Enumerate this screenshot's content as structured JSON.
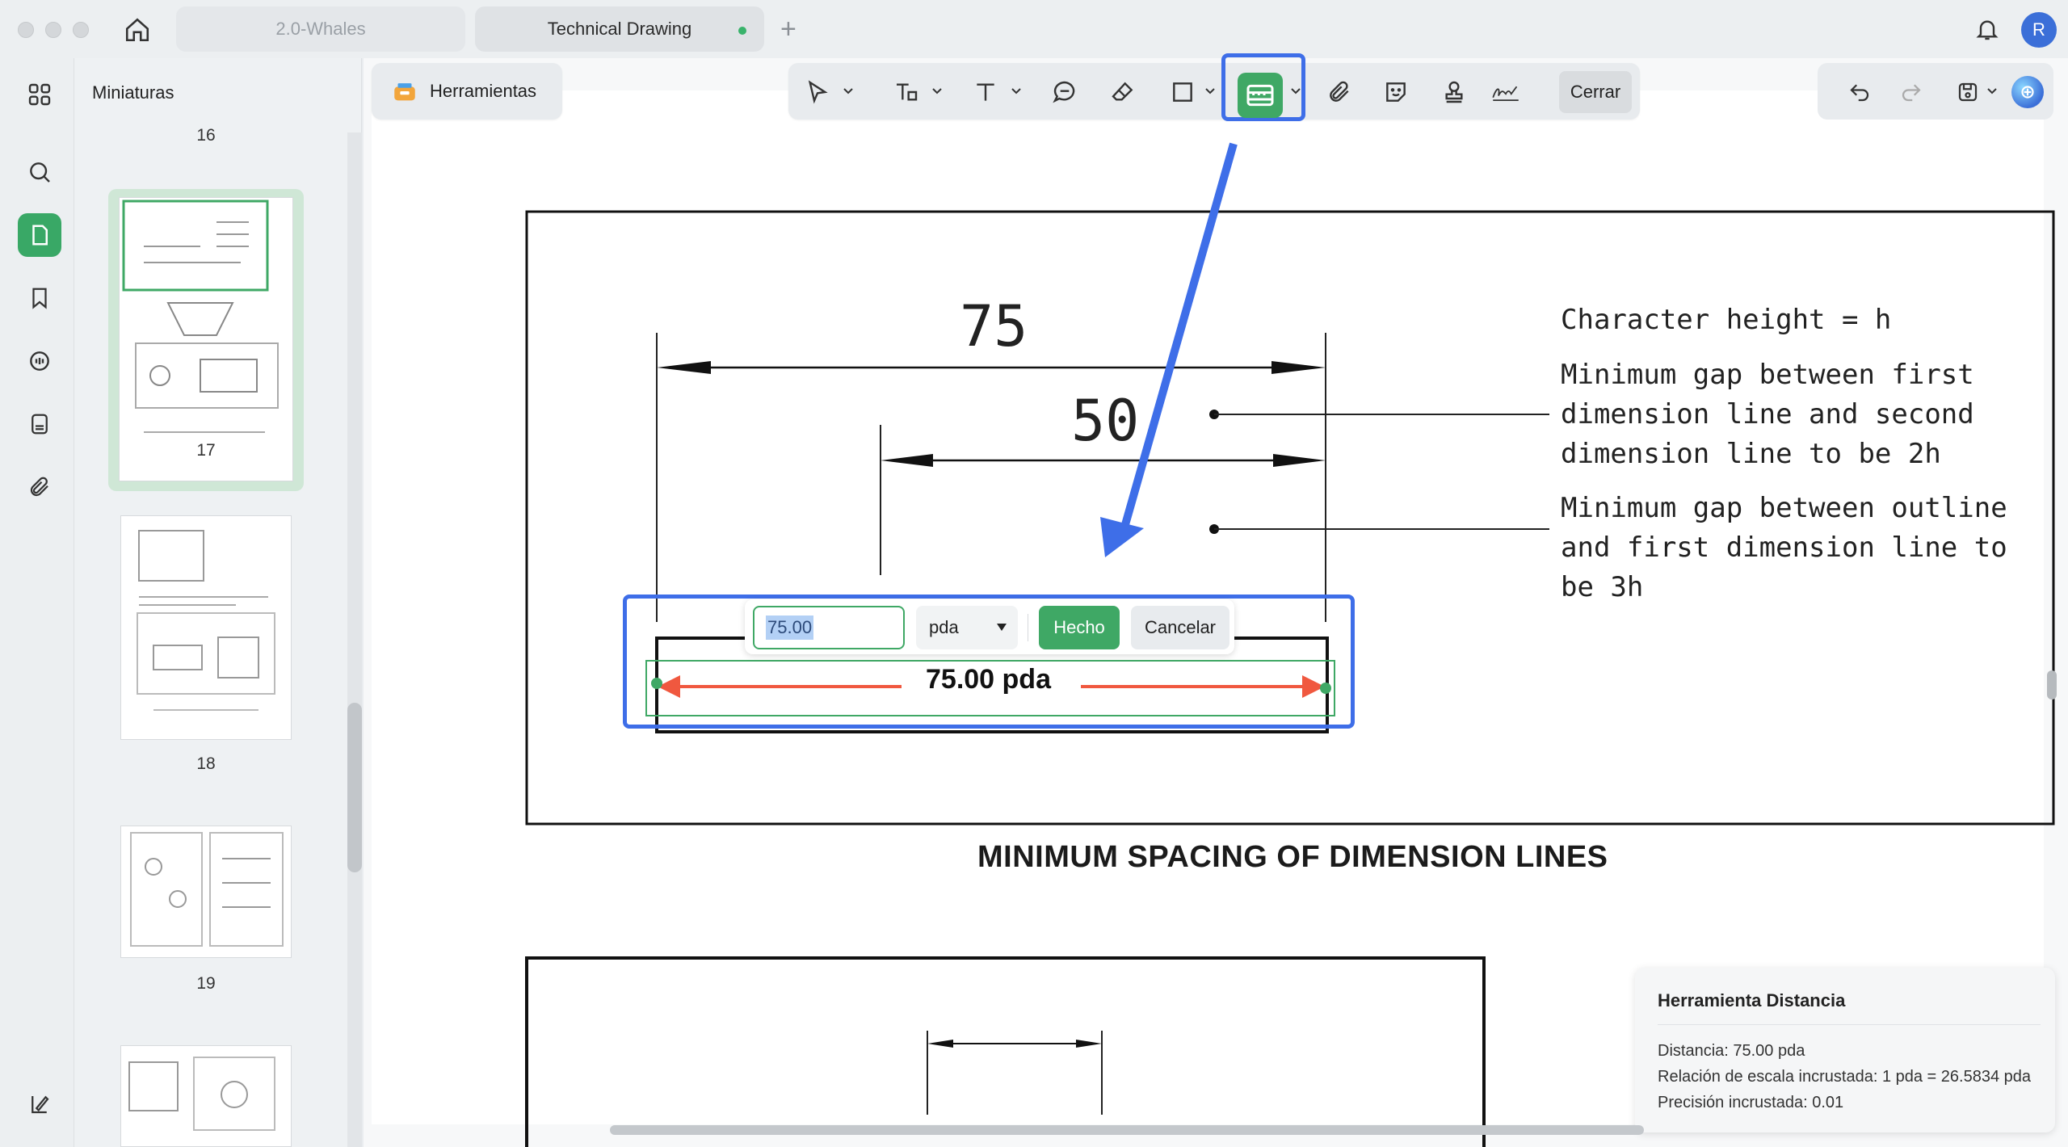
{
  "tabs": [
    {
      "label": "2.0-Whales",
      "active": false
    },
    {
      "label": "Technical Drawing",
      "active": true
    }
  ],
  "user": {
    "avatar_initial": "R"
  },
  "sidebar": {
    "title": "Miniaturas",
    "pages": [
      "16",
      "17",
      "18",
      "19"
    ],
    "selected_page": "17"
  },
  "toolbar": {
    "tools_label": "Herramientas",
    "close_label": "Cerrar",
    "active_tool": "measure-distance",
    "accent": "#3fa865",
    "highlight": "#3e6ee8"
  },
  "drawing": {
    "dim_top": "75",
    "dim_mid": "50",
    "note1": "Character height = h",
    "note2": "Minimum gap between first\ndimension line and second\ndimension line to be 2h",
    "note3": "Minimum gap between outline\nand first dimension line to\nbe 3h",
    "caption": "MINIMUM SPACING OF DIMENSION LINES"
  },
  "measurement": {
    "value": "75.00",
    "unit": "pda",
    "done_label": "Hecho",
    "cancel_label": "Cancelar",
    "label": "75.00 pda",
    "arrow_color": "#f0583f"
  },
  "info_panel": {
    "title": "Herramienta Distancia",
    "distance": "Distancia: 75.00 pda",
    "scale": "Relación de escala incrustada: 1 pda = 26.5834 pda",
    "precision": "Precisión incrustada: 0.01"
  }
}
